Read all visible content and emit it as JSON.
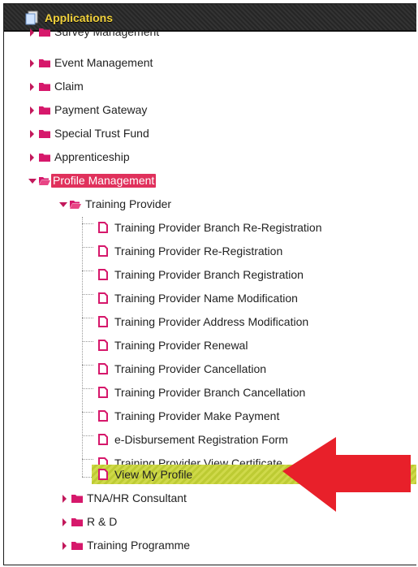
{
  "header": {
    "title": "Applications"
  },
  "tree": {
    "top_partial": "Survey Management",
    "top_level": [
      {
        "label": "Event Management"
      },
      {
        "label": "Claim"
      },
      {
        "label": "Payment Gateway"
      },
      {
        "label": "Special Trust Fund"
      },
      {
        "label": "Apprenticeship"
      }
    ],
    "profile_management": {
      "label": "Profile Management",
      "training_provider": {
        "label": "Training Provider",
        "items": [
          {
            "label": "Training Provider Branch Re-Registration"
          },
          {
            "label": "Training Provider Re-Registration"
          },
          {
            "label": "Training Provider Branch Registration"
          },
          {
            "label": "Training Provider Name Modification"
          },
          {
            "label": "Training Provider Address Modification"
          },
          {
            "label": "Training Provider Renewal"
          },
          {
            "label": "Training Provider Cancellation"
          },
          {
            "label": "Training Provider Branch Cancellation"
          },
          {
            "label": "Training Provider Make Payment"
          },
          {
            "label": "e-Disbursement Registration Form"
          },
          {
            "label": "Training Provider View Certificate"
          },
          {
            "label": "View My Profile"
          }
        ]
      },
      "siblings": [
        {
          "label": "TNA/HR Consultant"
        },
        {
          "label": "R & D"
        },
        {
          "label": "Training Programme"
        }
      ]
    }
  },
  "colors": {
    "accent": "#e0315c",
    "selected_row": "#c5d33a",
    "header_text": "#f2d23c",
    "annotation_arrow": "#e8202a"
  }
}
